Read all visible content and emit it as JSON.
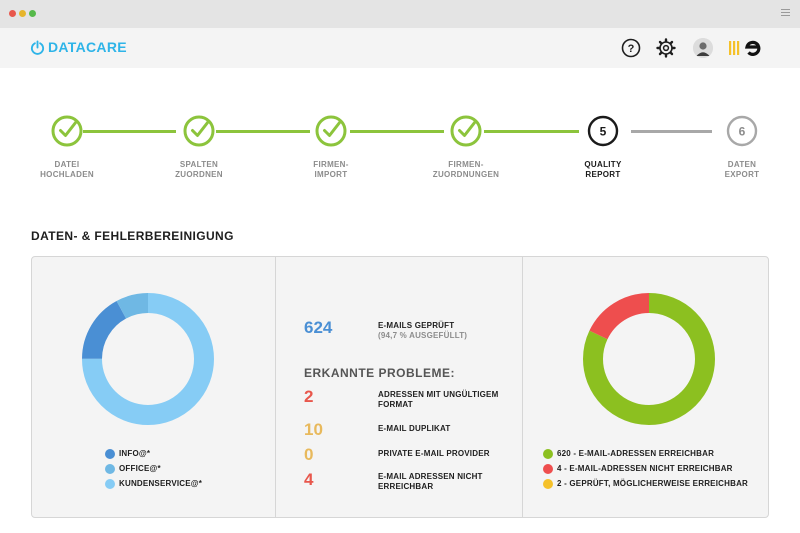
{
  "window": {
    "menu_icon": "hamburger-icon"
  },
  "header": {
    "logo_text": "DATACARE",
    "icons": [
      "help-icon",
      "gear-icon",
      "avatar",
      "brand-logo"
    ],
    "accent": "#2eb4e8"
  },
  "stepper": {
    "colors": {
      "done": "#8cc43c",
      "current": "#1b1b1b",
      "pending": "#a8a8a8"
    },
    "steps": [
      {
        "number": "1",
        "label": "DATEI\nHOCHLADEN",
        "state": "done"
      },
      {
        "number": "2",
        "label": "SPALTEN\nZUORDNEN",
        "state": "done"
      },
      {
        "number": "3",
        "label": "FIRMEN-\nIMPORT",
        "state": "done"
      },
      {
        "number": "4",
        "label": "FIRMEN-\nZUORDNUNGEN",
        "state": "done"
      },
      {
        "number": "5",
        "label": "QUALITY\nREPORT",
        "state": "current"
      },
      {
        "number": "6",
        "label": "DATEN\nEXPORT",
        "state": "pending"
      }
    ]
  },
  "section": {
    "title": "DATEN- & FEHLERBEREINIGUNG"
  },
  "left_chart": {
    "segments": [
      {
        "label": "INFO@*",
        "value": 17,
        "color": "#4a8fd4"
      },
      {
        "label": "OFFICE@*",
        "value": 8,
        "color": "#6fb8e4"
      },
      {
        "label": "KUNDENSERVICE@*",
        "value": 75,
        "color": "#86ccf5"
      }
    ]
  },
  "stats": {
    "checked": {
      "value": "624",
      "label": "E-MAILS GEPRÜFT",
      "sub": "(94,7 % AUSGEFÜLLT)",
      "color": "#4a8fd4"
    },
    "issues_title": "ERKANNTE PROBLEME:",
    "issues": [
      {
        "value": "2",
        "label": "ADRESSEN MIT UNGÜLTIGEM FORMAT",
        "color": "#e8574c"
      },
      {
        "value": "10",
        "label": "E-MAIL DUPLIKAT",
        "color": "#e8b95c"
      },
      {
        "value": "0",
        "label": "PRIVATE E-MAIL PROVIDER",
        "color": "#e8b95c"
      },
      {
        "value": "4",
        "label": "E-MAIL ADRESSEN NICHT ERREICHBAR",
        "color": "#e8574c"
      }
    ]
  },
  "right_chart": {
    "segments": [
      {
        "label": "620 - E-MAIL-ADRESSEN ERREICHBAR",
        "value": 82,
        "color": "#8cc020"
      },
      {
        "label": "4 - E-MAIL-ADRESSEN NICHT ERREICHBAR",
        "value": 18,
        "color": "#ee4e4e"
      },
      {
        "label": "2 - GEPRÜFT, MÖGLICHERWEISE ERREICHBAR",
        "value": 0,
        "color": "#f5c12a"
      }
    ]
  }
}
